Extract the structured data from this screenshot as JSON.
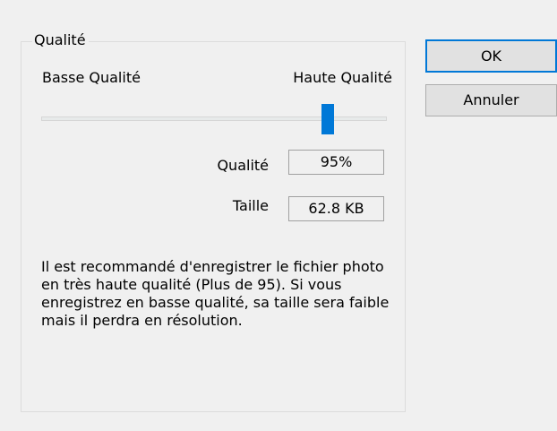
{
  "group": {
    "title": "Qualité"
  },
  "slider": {
    "low_label": "Basse Qualité",
    "high_label": "Haute Qualité",
    "value_percent": 95
  },
  "fields": {
    "quality_label": "Qualité",
    "quality_value": "95%",
    "size_label": "Taille",
    "size_value": "62.8 KB"
  },
  "help": {
    "text": "Il est recommandé d'enregistrer le fichier photo en très haute qualité (Plus de 95). Si vous enregistrez en basse qualité, sa taille sera faible mais il perdra en résolution."
  },
  "buttons": {
    "ok_label": "OK",
    "cancel_label": "Annuler"
  },
  "colors": {
    "accent": "#0078d7",
    "background": "#f0f0f0"
  }
}
